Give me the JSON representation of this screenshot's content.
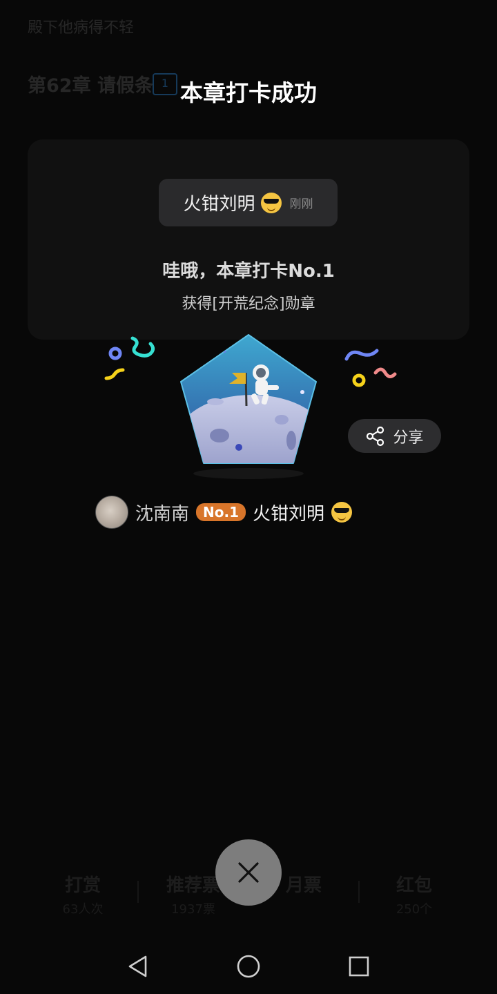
{
  "background": {
    "subtitle": "殿下他病得不轻",
    "chapter_title": "第62章 请假条",
    "chapter_badge": "1",
    "stats": [
      {
        "title": "打赏",
        "sub": "63人次"
      },
      {
        "title": "推荐票",
        "sub": "1937票"
      },
      {
        "title": "月票",
        "sub": ""
      },
      {
        "title": "红包",
        "sub": "250个"
      }
    ]
  },
  "dialog": {
    "title": "本章打卡成功",
    "toast_name": "火钳刘明",
    "toast_time": "刚刚",
    "wow_text": "哇哦，本章打卡No.1",
    "gain_text": "获得[开荒纪念]勋章",
    "share_label": "分享",
    "rank_user": "沈南南",
    "rank_no": "No.1",
    "rank_name": "火钳刘明"
  },
  "icons": {
    "emoji": "sunglasses-face-emoji",
    "share": "share-icon",
    "close": "close-icon",
    "nav": [
      "back-icon",
      "home-icon",
      "recent-apps-icon"
    ]
  },
  "colors": {
    "rank_badge": "#d8752a",
    "badge_sky_top": "#3fa8d0",
    "badge_sky_bottom": "#2d4f9c"
  }
}
